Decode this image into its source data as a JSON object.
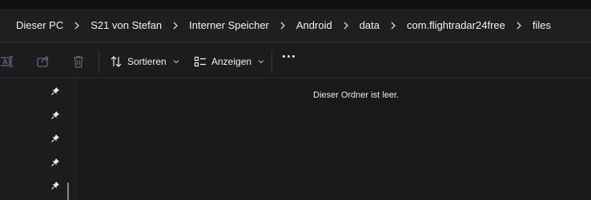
{
  "breadcrumb": {
    "items": [
      "Dieser PC",
      "S21 von Stefan",
      "Interner Speicher",
      "Android",
      "data",
      "com.flightradar24free",
      "files"
    ]
  },
  "toolbar": {
    "sort_label": "Sortieren",
    "view_label": "Anzeigen",
    "icons": [
      "rename-icon",
      "share-icon",
      "delete-icon",
      "sort-icon",
      "view-icon",
      "more-icon"
    ]
  },
  "sidebar": {
    "pinned_count": 5
  },
  "content": {
    "empty_message": "Dieser Ordner ist leer."
  },
  "colors": {
    "background": "#1c1c1c",
    "content_background": "#191919",
    "text": "#f2f2f2",
    "disabled_icon": "#5b6b86"
  }
}
